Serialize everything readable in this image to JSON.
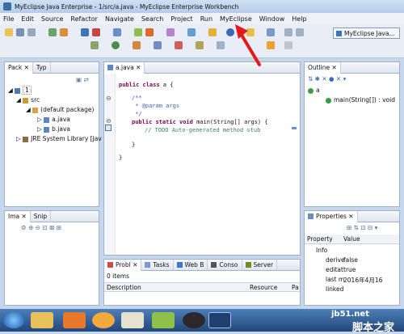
{
  "window": {
    "title": "MyEclipse Java Enterprise - 1/src/a.java - MyEclipse Enterprise Workbench"
  },
  "menu": [
    "File",
    "Edit",
    "Source",
    "Refactor",
    "Navigate",
    "Search",
    "Project",
    "Run",
    "MyEclipse",
    "Window",
    "Help"
  ],
  "perspective": {
    "label": "MyEclipse Java..."
  },
  "package_explorer": {
    "tabs": [
      "Pack",
      "Typ"
    ],
    "project": "1",
    "src": "src",
    "default_package": "(default package)",
    "files": [
      "a.java",
      "b.java"
    ],
    "jre": "JRE System Library [Jav"
  },
  "editor": {
    "tab": "a.java",
    "lines": {
      "class_kw": "public class",
      "class_name": " a {",
      "doc_open": "/**",
      "doc_param": " * @param args",
      "doc_close": " */",
      "main_kw": "public static void",
      "main_sig": " main(String[] args) {",
      "todo": "// TODO Auto-generated method stub",
      "brace_inner": "}",
      "brace_outer": "}"
    }
  },
  "outline": {
    "title": "Outline",
    "class": "a",
    "method": "main(String[]) : void"
  },
  "image_view": {
    "tabs": [
      "Ima",
      "Snip"
    ]
  },
  "properties": {
    "title": "Properties",
    "headers": [
      "Property",
      "Value"
    ],
    "section": "Info",
    "rows": [
      {
        "prop": "derive",
        "value": "false"
      },
      {
        "prop": "editat",
        "value": "true"
      },
      {
        "prop": "last m",
        "value": "2016年4月16"
      },
      {
        "prop": "linked",
        "value": ""
      }
    ]
  },
  "problems": {
    "tabs": [
      "Probl",
      "Tasks",
      "Web B",
      "Conso",
      "Server"
    ],
    "count": "0 items",
    "headers": [
      "Description",
      "Resource",
      "Pa"
    ]
  },
  "watermark": {
    "site": "jb51.net",
    "brand": "脚本之家"
  },
  "colors": {
    "arrow": "#e41a1a",
    "keyword": "#7f0055",
    "comment": "#3f7f5f",
    "javadoc": "#3f5fbf"
  }
}
